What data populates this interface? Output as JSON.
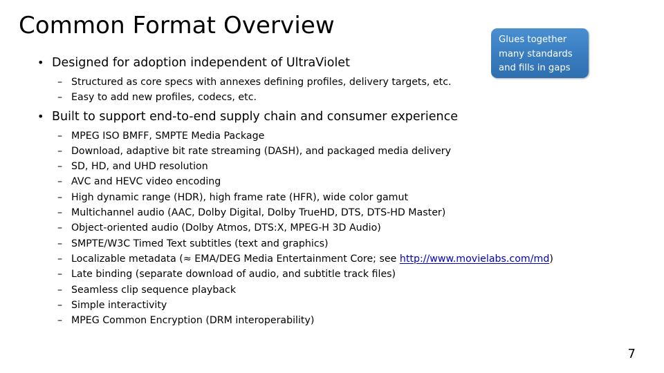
{
  "slide": {
    "title": "Common Format Overview",
    "page_number": "7",
    "background_color": "#ffffff",
    "text_color": "#000000"
  },
  "callout": {
    "name": "glues-together-callout",
    "line1": "Glues together",
    "line2": "many standards",
    "line3": "and fills in gaps",
    "fill_color": "#3d82c4",
    "text_color": "#ffffff"
  },
  "content": {
    "bullet_marker_level1": "•",
    "bullet_marker_level2": "–",
    "groups": [
      {
        "heading": "Designed for adoption independent of UltraViolet",
        "items": [
          "Structured as core specs with annexes defining profiles, delivery targets, etc.",
          "Easy to add new profiles, codecs, etc."
        ]
      },
      {
        "heading": "Built to support end-to-end supply chain and consumer experience",
        "items": [
          "MPEG ISO BMFF, SMPTE Media Package",
          "Download, adaptive bit rate streaming (DASH), and packaged media delivery",
          "SD, HD, and UHD resolution",
          "AVC and HEVC video encoding",
          "High dynamic range (HDR), high frame rate (HFR), wide color gamut",
          "Multichannel audio (AAC, Dolby Digital, Dolby TrueHD, DTS, DTS-HD Master)",
          "Object-oriented audio (Dolby Atmos, DTS:X, MPEG-H 3D Audio)",
          "SMPTE/W3C Timed Text subtitles (text and graphics)",
          "Late binding (separate download of audio, and subtitle track files)",
          "Seamless clip sequence playback",
          "Simple interactivity",
          "MPEG Common Encryption (DRM interoperability)"
        ]
      }
    ],
    "link_item": {
      "prefix": "Localizable metadata (≈ EMA/DEG Media Entertainment Core; see ",
      "link_text": "http://www.movielabs.com/md",
      "suffix": ")",
      "link_color": "#0000C0"
    }
  }
}
